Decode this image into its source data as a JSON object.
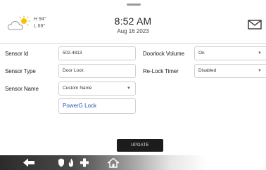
{
  "header": {
    "weather": {
      "icon": "partly-sunny-icon",
      "high": "H 94°",
      "low": "L 69°"
    },
    "time": "8:52 AM",
    "date": "Aug 16 2023",
    "mail_icon": "envelope-icon"
  },
  "form": {
    "sensor_id": {
      "label": "Sensor Id",
      "value": "502-4813"
    },
    "sensor_type": {
      "label": "Sensor Type",
      "value": "Door Lock"
    },
    "sensor_name": {
      "label": "Sensor Name",
      "value": "Custom Name"
    },
    "power_name": {
      "value": "PowerG Lock"
    },
    "doorlock_volume": {
      "label": "Doorlock Volume",
      "value": "On"
    },
    "relock_timer": {
      "label": "Re-Lock Timer",
      "value": "Disabled"
    }
  },
  "update_button": {
    "label": "UPDATE"
  },
  "navbar": {
    "icons": [
      "back-arrow-icon",
      "shield-icon",
      "fire-icon",
      "medical-cross-icon",
      "home-icon"
    ]
  },
  "colors": {
    "accent_text": "#2b58b0",
    "button": "#1c1c1c"
  }
}
